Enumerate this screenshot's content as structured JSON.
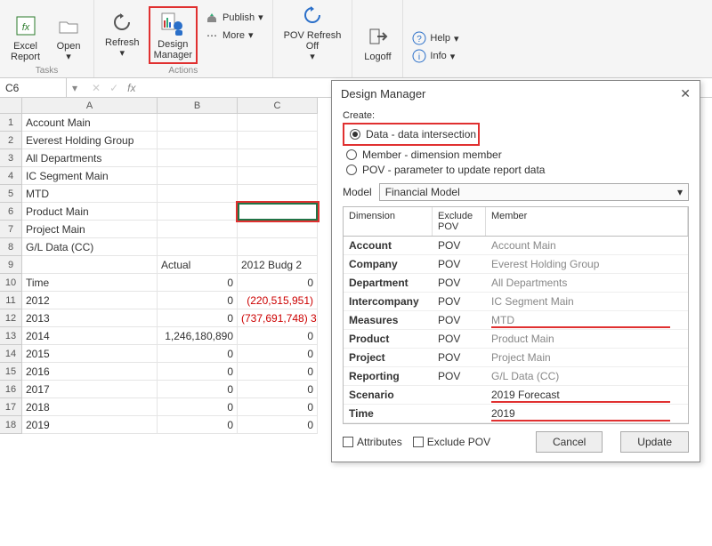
{
  "ribbon": {
    "groups": {
      "tasks": "Tasks",
      "actions": "Actions"
    },
    "excel_report": "Excel\nReport",
    "open": "Open",
    "refresh": "Refresh",
    "design_manager": "Design\nManager",
    "publish": "Publish",
    "more": "More",
    "pov_refresh_off": "POV Refresh\nOff",
    "logoff": "Logoff",
    "help": "Help",
    "info": "Info"
  },
  "namebox": "C6",
  "columns": [
    "A",
    "B",
    "C"
  ],
  "rows": [
    {
      "n": "1",
      "A": "Account Main",
      "B": "",
      "C": ""
    },
    {
      "n": "2",
      "A": "Everest Holding Group",
      "B": "",
      "C": ""
    },
    {
      "n": "3",
      "A": "All Departments",
      "B": "",
      "C": ""
    },
    {
      "n": "4",
      "A": "IC Segment Main",
      "B": "",
      "C": ""
    },
    {
      "n": "5",
      "A": "MTD",
      "B": "",
      "C": ""
    },
    {
      "n": "6",
      "A": "Product Main",
      "B": "",
      "C": ""
    },
    {
      "n": "7",
      "A": "Project Main",
      "B": "",
      "C": ""
    },
    {
      "n": "8",
      "A": "G/L Data (CC)",
      "B": "",
      "C": ""
    },
    {
      "n": "9",
      "A": "",
      "B": "Actual",
      "C": "2012 Budg",
      "Balign": "left",
      "Calign": "left"
    },
    {
      "n": "10",
      "A": "Time",
      "B": "0",
      "C": "0"
    },
    {
      "n": "11",
      "A": "   2012",
      "B": "0",
      "C": "(220,515,951)",
      "Cneg": true
    },
    {
      "n": "12",
      "A": "   2013",
      "B": "0",
      "C": "(737,691,748)",
      "Cneg": true
    },
    {
      "n": "13",
      "A": "   2014",
      "B": "1,246,180,890",
      "C": "0"
    },
    {
      "n": "14",
      "A": "   2015",
      "B": "0",
      "C": "0"
    },
    {
      "n": "15",
      "A": "   2016",
      "B": "0",
      "C": "0"
    },
    {
      "n": "16",
      "A": "   2017",
      "B": "0",
      "C": "0"
    },
    {
      "n": "17",
      "A": "   2018",
      "B": "0",
      "C": "0"
    },
    {
      "n": "18",
      "A": "   2019",
      "B": "0",
      "C": "0"
    }
  ],
  "colC_extra_row12": "3",
  "dialog": {
    "title": "Design Manager",
    "create_label": "Create:",
    "radios": {
      "data": "Data - data intersection",
      "member": "Member - dimension member",
      "pov": "POV - parameter to update report data"
    },
    "model_label": "Model",
    "model_value": "Financial Model",
    "headers": {
      "dim": "Dimension",
      "excl": "Exclude POV",
      "mem": "Member"
    },
    "dims": [
      {
        "dim": "Account",
        "excl": "POV",
        "mem": "Account Main"
      },
      {
        "dim": "Company",
        "excl": "POV",
        "mem": "Everest Holding Group"
      },
      {
        "dim": "Department",
        "excl": "POV",
        "mem": "All Departments"
      },
      {
        "dim": "Intercompany",
        "excl": "POV",
        "mem": "IC Segment Main"
      },
      {
        "dim": "Measures",
        "excl": "POV",
        "mem": "MTD",
        "u": true
      },
      {
        "dim": "Product",
        "excl": "POV",
        "mem": "Product Main"
      },
      {
        "dim": "Project",
        "excl": "POV",
        "mem": "Project Main"
      },
      {
        "dim": "Reporting",
        "excl": "POV",
        "mem": "G/L Data (CC)"
      },
      {
        "dim": "Scenario",
        "excl": "",
        "mem": "2019 Forecast",
        "u": true,
        "black": true
      },
      {
        "dim": "Time",
        "excl": "",
        "mem": "2019",
        "u": true,
        "black": true
      }
    ],
    "attributes": "Attributes",
    "exclude_pov": "Exclude POV",
    "cancel": "Cancel",
    "update": "Update"
  }
}
